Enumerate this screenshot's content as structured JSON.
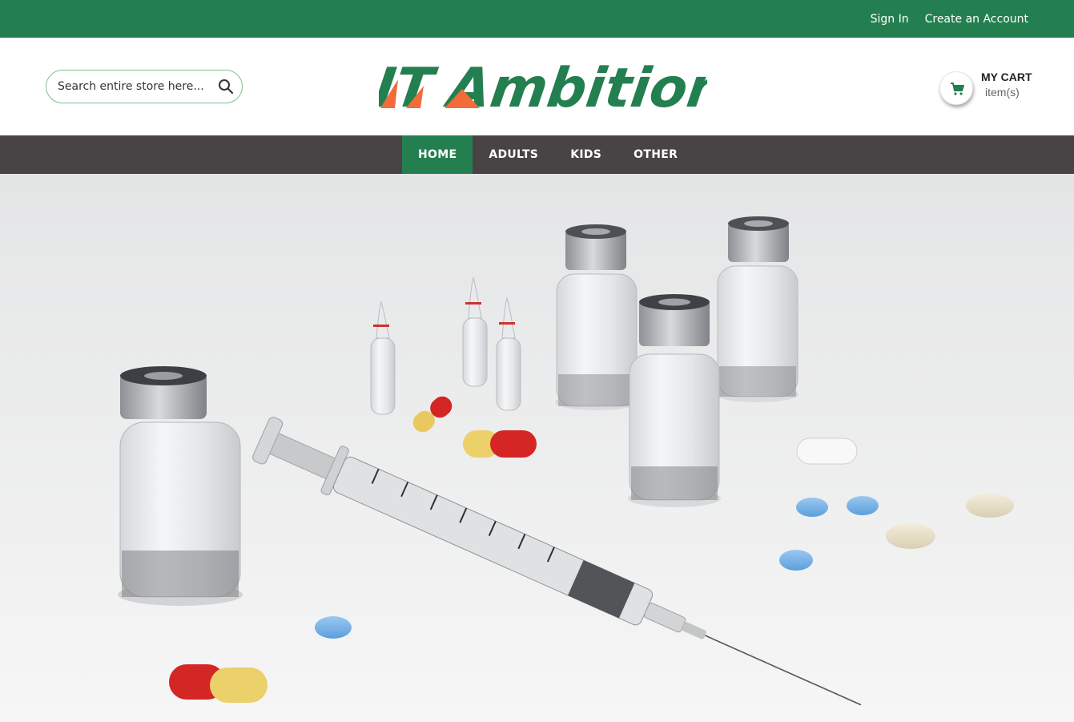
{
  "topbar": {
    "sign_in": "Sign In",
    "create_account": "Create an Account"
  },
  "header": {
    "search": {
      "placeholder": "Search entire store here..."
    },
    "logo": {
      "text_it": "IT",
      "text_ambition": "Ambition"
    },
    "cart": {
      "title": "MY CART",
      "subtitle": "item(s)"
    }
  },
  "nav": {
    "items": [
      {
        "label": "HOME",
        "active": true
      },
      {
        "label": "ADULTS",
        "active": false
      },
      {
        "label": "KIDS",
        "active": false
      },
      {
        "label": "OTHER",
        "active": false
      }
    ]
  },
  "colors": {
    "brand_green": "#247f50",
    "logo_orange": "#f26b3a",
    "nav_bg": "#484344"
  },
  "icons": {
    "search": "search-icon",
    "cart": "shopping-cart-icon"
  }
}
